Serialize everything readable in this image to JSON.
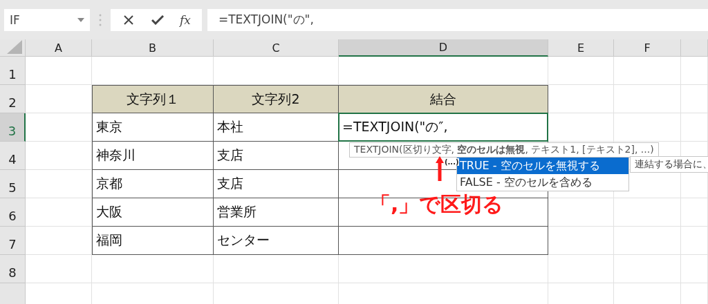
{
  "name_box": {
    "value": "IF"
  },
  "formula_bar": {
    "fx": "fx",
    "formula": "=TEXTJOIN(\"の\","
  },
  "columns": [
    {
      "label": "A",
      "selected": false
    },
    {
      "label": "B",
      "selected": false
    },
    {
      "label": "C",
      "selected": false
    },
    {
      "label": "D",
      "selected": true
    },
    {
      "label": "E",
      "selected": false
    },
    {
      "label": "F",
      "selected": false
    }
  ],
  "row_numbers": [
    {
      "label": "1",
      "selected": false
    },
    {
      "label": "2",
      "selected": false
    },
    {
      "label": "3",
      "selected": true
    },
    {
      "label": "4",
      "selected": false
    },
    {
      "label": "5",
      "selected": false
    },
    {
      "label": "6",
      "selected": false
    },
    {
      "label": "7",
      "selected": false
    },
    {
      "label": "8",
      "selected": false
    }
  ],
  "table": {
    "headers": [
      "文字列１",
      "文字列2",
      "結合"
    ],
    "rows": [
      [
        "東京",
        "本社",
        "=TEXTJOIN(\"の″,"
      ],
      [
        "神奈川",
        "支店",
        ""
      ],
      [
        "京都",
        "支店",
        ""
      ],
      [
        "大阪",
        "営業所",
        ""
      ],
      [
        "福岡",
        "センター",
        ""
      ]
    ]
  },
  "tooltip": {
    "text": "TEXTJOIN(区切り文字, **空のセルは無視**, テキスト1, [テキスト2], ...)"
  },
  "autocomplete": {
    "ellipsis": "(...)",
    "items": [
      {
        "label": "TRUE - 空のセルを無視する",
        "selected": true
      },
      {
        "label": "FALSE - 空のセルを含める",
        "selected": false
      }
    ]
  },
  "hint": "連結する場合に、",
  "annotation": "「,」で区切る"
}
